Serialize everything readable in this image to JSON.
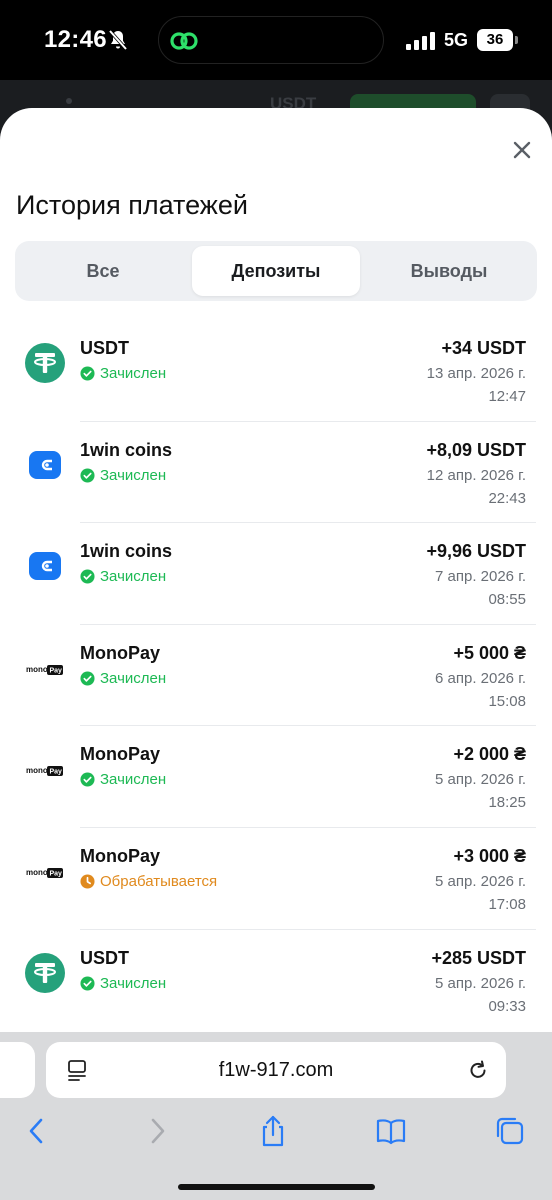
{
  "status_bar": {
    "time": "12:46",
    "network": "5G",
    "battery": "36"
  },
  "background_app": {
    "currency": "USDT"
  },
  "sheet": {
    "title": "История платежей",
    "tabs": [
      {
        "label": "Все",
        "active": false
      },
      {
        "label": "Депозиты",
        "active": true
      },
      {
        "label": "Выводы",
        "active": false
      }
    ],
    "transactions": [
      {
        "icon": "tether-icon",
        "name": "USDT",
        "status": "Зачислен",
        "status_type": "success",
        "amount": "+34 USDT",
        "date": "13 апр. 2026 г.",
        "time": "12:47"
      },
      {
        "icon": "wallet-icon",
        "name": "1win coins",
        "status": "Зачислен",
        "status_type": "success",
        "amount": "+8,09 USDT",
        "date": "12 апр. 2026 г.",
        "time": "22:43"
      },
      {
        "icon": "wallet-icon",
        "name": "1win coins",
        "status": "Зачислен",
        "status_type": "success",
        "amount": "+9,96 USDT",
        "date": "7 апр. 2026 г.",
        "time": "08:55"
      },
      {
        "icon": "monopay-logo",
        "name": "MonoPay",
        "status": "Зачислен",
        "status_type": "success",
        "amount": "+5 000 ₴",
        "date": "6 апр. 2026 г.",
        "time": "15:08"
      },
      {
        "icon": "monopay-logo",
        "name": "MonoPay",
        "status": "Зачислен",
        "status_type": "success",
        "amount": "+2 000 ₴",
        "date": "5 апр. 2026 г.",
        "time": "18:25"
      },
      {
        "icon": "monopay-logo",
        "name": "MonoPay",
        "status": "Обрабатывается",
        "status_type": "pending",
        "amount": "+3 000 ₴",
        "date": "5 апр. 2026 г.",
        "time": "17:08"
      },
      {
        "icon": "tether-icon",
        "name": "USDT",
        "status": "Зачислен",
        "status_type": "success",
        "amount": "+285 USDT",
        "date": "5 апр. 2026 г.",
        "time": "09:33"
      }
    ],
    "monopay_logo_text": {
      "mono": "mono",
      "pay": "Pay"
    }
  },
  "browser": {
    "url": "f1w-917.com"
  },
  "colors": {
    "success": "#1db954",
    "pending": "#e08a1e",
    "tether": "#26a17b",
    "wallet": "#1877f2",
    "ios_blue": "#2a7cf6"
  }
}
